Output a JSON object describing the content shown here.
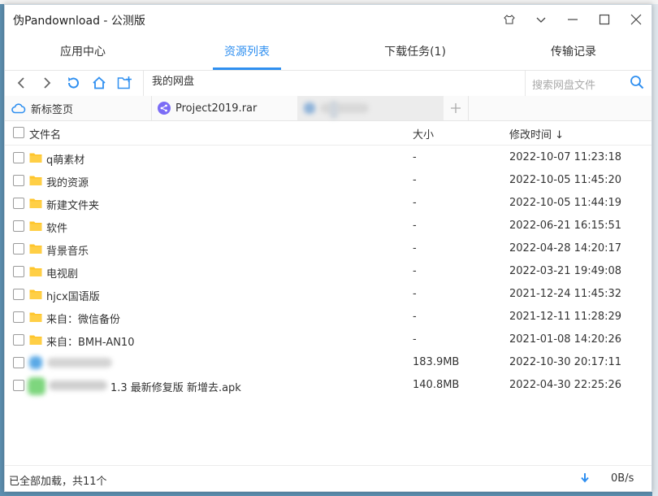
{
  "window": {
    "title": "伪Pandownload - 公测版",
    "controls": [
      "skin-icon",
      "chevron-down-icon",
      "minimize-icon",
      "maximize-icon",
      "close-icon"
    ]
  },
  "tabs": [
    {
      "label": "应用中心",
      "active": false
    },
    {
      "label": "资源列表",
      "active": true
    },
    {
      "label": "下载任务(1)",
      "active": false
    },
    {
      "label": "传输记录",
      "active": false
    }
  ],
  "toolbar": {
    "path": "我的网盘",
    "search_placeholder": "搜索网盘文件"
  },
  "file_tabs": [
    {
      "label": "新标签页",
      "icon": "cloud-icon"
    },
    {
      "label": "Project2019.rar",
      "icon": "share-icon"
    }
  ],
  "columns": {
    "name": "文件名",
    "size": "大小",
    "modified": "修改时间 ↓"
  },
  "files": [
    {
      "name": "q萌素材",
      "size": "-",
      "modified": "2022-10-07 11:23:18",
      "type": "folder"
    },
    {
      "name": "我的资源",
      "size": "-",
      "modified": "2022-10-05 11:45:20",
      "type": "folder"
    },
    {
      "name": "新建文件夹",
      "size": "-",
      "modified": "2022-10-05 11:44:19",
      "type": "folder"
    },
    {
      "name": "软件",
      "size": "-",
      "modified": "2022-06-21 16:15:51",
      "type": "folder"
    },
    {
      "name": "背景音乐",
      "size": "-",
      "modified": "2022-04-28 14:20:17",
      "type": "folder"
    },
    {
      "name": "电视剧",
      "size": "-",
      "modified": "2022-03-21 19:49:08",
      "type": "folder"
    },
    {
      "name": "hjcx国语版",
      "size": "-",
      "modified": "2021-12-24 11:45:32",
      "type": "folder"
    },
    {
      "name": "来自：微信备份",
      "size": "-",
      "modified": "2021-12-11 11:28:29",
      "type": "folder"
    },
    {
      "name": "来自：BMH-AN10",
      "size": "-",
      "modified": "2021-01-08 14:20:26",
      "type": "folder"
    },
    {
      "name": "",
      "size": "183.9MB",
      "modified": "2022-10-30 20:17:11",
      "type": "file-blurred"
    },
    {
      "name": "1.3 最新修复版 新增去.apk",
      "size": "140.8MB",
      "modified": "2022-04-30 22:25:26",
      "type": "apk-blurred"
    }
  ],
  "status": {
    "text": "已全部加载，共11个",
    "speed": "0B/s"
  },
  "colors": {
    "accent": "#2f8ff0",
    "folder": "#ffc52b"
  }
}
